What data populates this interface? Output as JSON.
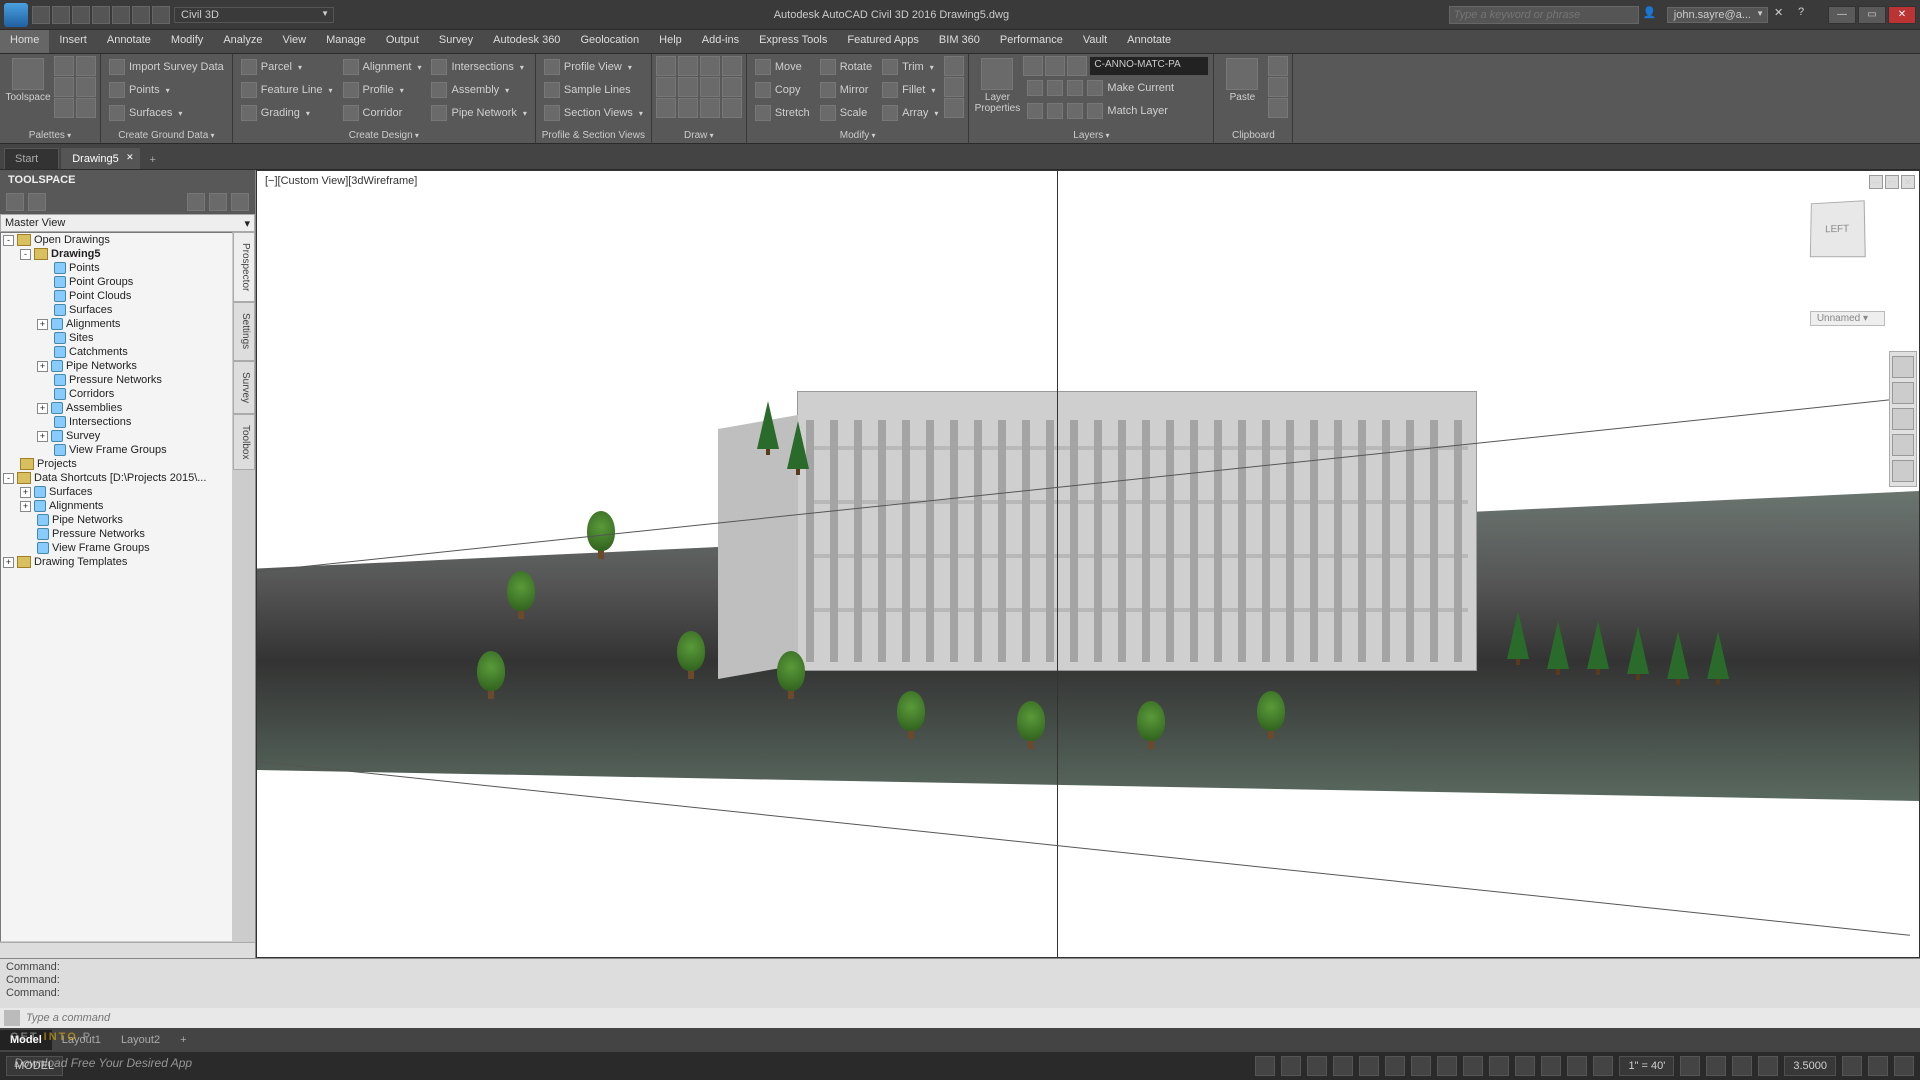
{
  "app": {
    "qat_dropdown": "Civil 3D",
    "title": "Autodesk AutoCAD Civil 3D 2016   Drawing5.dwg",
    "search_placeholder": "Type a keyword or phrase",
    "user": "john.sayre@a..."
  },
  "menu": {
    "tabs": [
      "Home",
      "Insert",
      "Annotate",
      "Modify",
      "Analyze",
      "View",
      "Manage",
      "Output",
      "Survey",
      "Autodesk 360",
      "Geolocation",
      "Help",
      "Add-ins",
      "Express Tools",
      "Featured Apps",
      "BIM 360",
      "Performance",
      "Vault",
      "Annotate"
    ],
    "active": 0
  },
  "ribbon": {
    "palettes": {
      "label": "Palettes",
      "big": "Toolspace"
    },
    "ground": {
      "label": "Create Ground Data",
      "import": "Import Survey Data",
      "points": "Points",
      "surfaces": "Surfaces"
    },
    "design": {
      "label": "Create Design",
      "parcel": "Parcel",
      "featureline": "Feature Line",
      "grading": "Grading",
      "alignment": "Alignment",
      "profile": "Profile",
      "corridor": "Corridor",
      "intersections": "Intersections",
      "assembly": "Assembly",
      "pipenet": "Pipe Network"
    },
    "profileviews": {
      "label": "Profile & Section Views",
      "profileview": "Profile View",
      "samplelines": "Sample Lines",
      "sectionviews": "Section Views"
    },
    "draw": {
      "label": "Draw"
    },
    "modify": {
      "label": "Modify",
      "move": "Move",
      "copy": "Copy",
      "stretch": "Stretch",
      "rotate": "Rotate",
      "mirror": "Mirror",
      "scale": "Scale",
      "trim": "Trim",
      "fillet": "Fillet",
      "array": "Array"
    },
    "layers": {
      "label": "Layers",
      "big": "Layer\nProperties",
      "current": "C-ANNO-MATC-PA",
      "makecurrent": "Make Current",
      "matchlayer": "Match Layer"
    },
    "clipboard": {
      "label": "Clipboard",
      "paste": "Paste"
    }
  },
  "filetabs": {
    "start": "Start",
    "active": "Drawing5"
  },
  "toolspace": {
    "title": "TOOLSPACE",
    "filter": "Master View",
    "sidetabs": [
      "Prospector",
      "Settings",
      "Survey",
      "Toolbox"
    ],
    "tree": [
      {
        "d": 0,
        "tw": "-",
        "ic": "f",
        "lbl": "Open Drawings"
      },
      {
        "d": 1,
        "tw": "-",
        "ic": "f",
        "lbl": "Drawing5",
        "bold": true
      },
      {
        "d": 2,
        "tw": "",
        "ic": "d",
        "lbl": "Points"
      },
      {
        "d": 2,
        "tw": "",
        "ic": "d",
        "lbl": "Point Groups"
      },
      {
        "d": 2,
        "tw": "",
        "ic": "d",
        "lbl": "Point Clouds"
      },
      {
        "d": 2,
        "tw": "",
        "ic": "d",
        "lbl": "Surfaces"
      },
      {
        "d": 2,
        "tw": "+",
        "ic": "d",
        "lbl": "Alignments"
      },
      {
        "d": 2,
        "tw": "",
        "ic": "d",
        "lbl": "Sites"
      },
      {
        "d": 2,
        "tw": "",
        "ic": "d",
        "lbl": "Catchments"
      },
      {
        "d": 2,
        "tw": "+",
        "ic": "d",
        "lbl": "Pipe Networks"
      },
      {
        "d": 2,
        "tw": "",
        "ic": "d",
        "lbl": "Pressure Networks"
      },
      {
        "d": 2,
        "tw": "",
        "ic": "d",
        "lbl": "Corridors"
      },
      {
        "d": 2,
        "tw": "+",
        "ic": "d",
        "lbl": "Assemblies"
      },
      {
        "d": 2,
        "tw": "",
        "ic": "d",
        "lbl": "Intersections"
      },
      {
        "d": 2,
        "tw": "+",
        "ic": "d",
        "lbl": "Survey"
      },
      {
        "d": 2,
        "tw": "",
        "ic": "d",
        "lbl": "View Frame Groups"
      },
      {
        "d": 0,
        "tw": "",
        "ic": "f",
        "lbl": "Projects"
      },
      {
        "d": 0,
        "tw": "-",
        "ic": "f",
        "lbl": "Data Shortcuts [D:\\Projects 2015\\..."
      },
      {
        "d": 1,
        "tw": "+",
        "ic": "d",
        "lbl": "Surfaces"
      },
      {
        "d": 1,
        "tw": "+",
        "ic": "d",
        "lbl": "Alignments"
      },
      {
        "d": 1,
        "tw": "",
        "ic": "d",
        "lbl": "Pipe Networks"
      },
      {
        "d": 1,
        "tw": "",
        "ic": "d",
        "lbl": "Pressure Networks"
      },
      {
        "d": 1,
        "tw": "",
        "ic": "d",
        "lbl": "View Frame Groups"
      },
      {
        "d": 0,
        "tw": "+",
        "ic": "f",
        "lbl": "Drawing Templates"
      }
    ]
  },
  "viewport": {
    "label": "[−][Custom View][3dWireframe]",
    "cubeface": "LEFT",
    "unnamed": "Unnamed"
  },
  "cmd": {
    "hist": [
      "Command:",
      "Command:",
      "Command:"
    ],
    "placeholder": "Type a command"
  },
  "layouts": {
    "tabs": [
      "Model",
      "Layout1",
      "Layout2"
    ],
    "active": 0
  },
  "status": {
    "model": "MODEL",
    "scale": "1\" = 40'",
    "decimal": "3.5000"
  },
  "watermark": {
    "a": "GET ",
    "b": "INTO",
    "c": " P",
    "sub": "Download Free Your Desired App"
  }
}
